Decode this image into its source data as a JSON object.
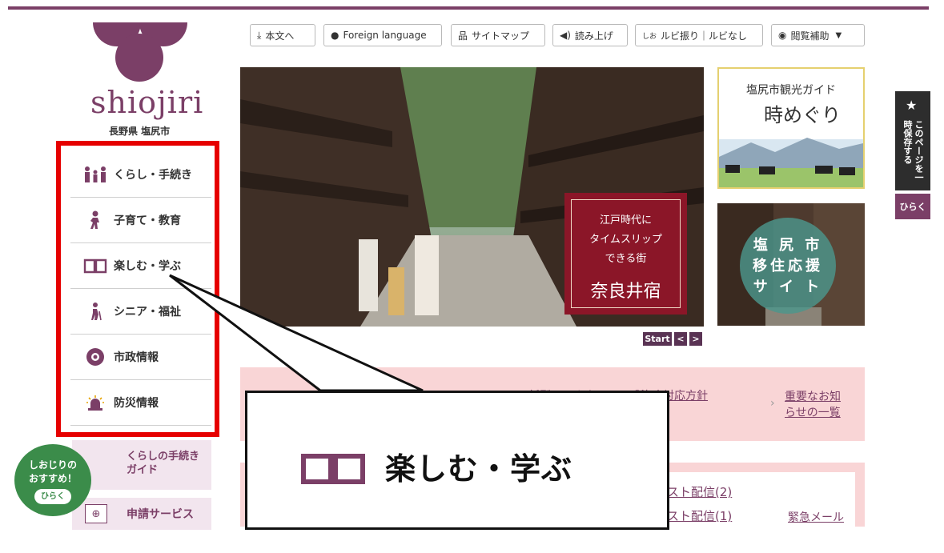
{
  "site": {
    "logo_text": "shiojiri",
    "logo_sub": "長野県 塩尻市",
    "brand_color": "#7b3f67"
  },
  "toolbar": {
    "main_text": "本文へ",
    "foreign": "Foreign language",
    "sitemap": "サイトマップ",
    "read_aloud": "読み上げ",
    "ruby": "ルビ振り｜ルビなし",
    "ruby_mark": "しお",
    "browse_assist": "閲覧補助"
  },
  "gnav": {
    "items": [
      {
        "label": "くらし・手続き",
        "icon": "family-icon"
      },
      {
        "label": "子育て・教育",
        "icon": "child-icon"
      },
      {
        "label": "楽しむ・学ぶ",
        "icon": "book-icon"
      },
      {
        "label": "シニア・福祉",
        "icon": "senior-icon"
      },
      {
        "label": "市政情報",
        "icon": "city-emblem-icon"
      },
      {
        "label": "防災情報",
        "icon": "siren-icon"
      }
    ],
    "highlight_color": "#e60000"
  },
  "slider": {
    "caption_lines": [
      "江戸時代に",
      "タイムスリップ",
      "できる街"
    ],
    "caption_title": "奈良井宿",
    "start": "Start",
    "prev": "<",
    "next": ">"
  },
  "banners": {
    "tourism_title": "塩尻市観光ガイド",
    "tourism_sub": "時めぐり",
    "migrate_lines": [
      "塩 尻 市",
      "移住応援",
      "サ イ ト"
    ]
  },
  "save_tab": {
    "label": "このページを一時保存する",
    "open": "ひらく"
  },
  "notices": {
    "important_text": "新型コロナウイルス感染症対応方針",
    "important_list": "重要なお知らせの一覧",
    "emergency_items": [
      "テスト配信(2)",
      "テスト配信(1)"
    ],
    "emergency_more": "緊急メール"
  },
  "sidebar": {
    "guide_label": "くらしの手続きガイド",
    "apply_label": "申請サービス",
    "recommend_label": "しおじりのおすすめ！",
    "recommend_open": "ひらく"
  },
  "callout": {
    "label": "楽しむ・学ぶ"
  }
}
